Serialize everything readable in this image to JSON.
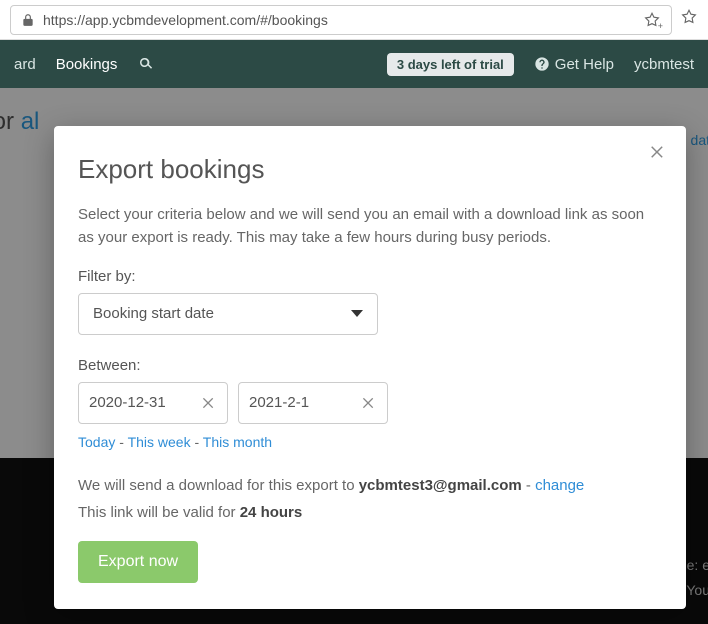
{
  "browser": {
    "url": "https://app.ycbmdevelopment.com/#/bookings"
  },
  "header": {
    "nav_dashboard_trunc": "ard",
    "nav_bookings": "Bookings",
    "trial_text": "3 days left of trial",
    "get_help": "Get Help",
    "user_trunc": "ycbmtest"
  },
  "bg": {
    "for_text": "for ",
    "all_text": "al",
    "date_trunc": "dat",
    "dark_line1": "e: e",
    "dark_line2": "You"
  },
  "modal": {
    "title": "Export bookings",
    "intro": "Select your criteria below and we will send you an email with a download link as soon as your export is ready. This may take a few hours during busy periods.",
    "filter_label": "Filter by:",
    "filter_value": "Booking start date",
    "between_label": "Between:",
    "date_start": "2020-12-31",
    "date_end": "2021-2-1",
    "quick_today": "Today",
    "quick_week": "This week",
    "quick_month": "This month",
    "sep": " - ",
    "email_prefix": "We will send a download for this export to ",
    "email": "ycbmtest3@gmail.com",
    "email_dash": " - ",
    "change": "change",
    "valid_prefix": "This link will be valid for ",
    "valid_duration": "24 hours",
    "export_btn": "Export now"
  }
}
